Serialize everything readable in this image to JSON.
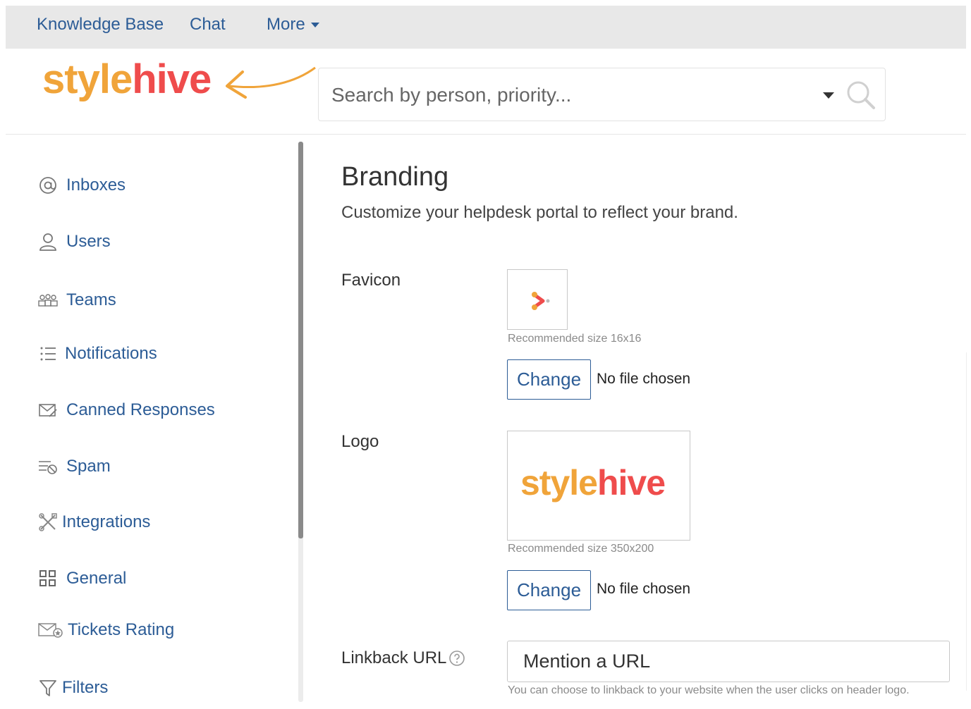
{
  "topnav": {
    "links": [
      {
        "label": "Knowledge Base"
      },
      {
        "label": "Chat"
      },
      {
        "label": "More"
      }
    ]
  },
  "brand": {
    "logo_part1": "style",
    "logo_part2": "hive",
    "colors": {
      "style": "#f0a43a",
      "hive": "#ef4c4c",
      "link": "#2c5c96"
    }
  },
  "search": {
    "placeholder": "Search by person, priority..."
  },
  "sidebar": {
    "items": [
      {
        "label": "Inboxes",
        "icon": "at-icon"
      },
      {
        "label": "Users",
        "icon": "user-icon"
      },
      {
        "label": "Teams",
        "icon": "teams-icon"
      },
      {
        "label": "Notifications",
        "icon": "list-icon"
      },
      {
        "label": "Canned Responses",
        "icon": "envelope-icon"
      },
      {
        "label": "Spam",
        "icon": "spam-icon"
      },
      {
        "label": "Integrations",
        "icon": "tools-icon"
      },
      {
        "label": "General",
        "icon": "grid-icon"
      },
      {
        "label": "Tickets Rating",
        "icon": "rating-envelope-icon"
      },
      {
        "label": "Filters",
        "icon": "funnel-icon"
      }
    ]
  },
  "main": {
    "title": "Branding",
    "subtitle": "Customize your helpdesk portal to reflect your brand.",
    "favicon": {
      "label": "Favicon",
      "hint": "Recommended size 16x16",
      "button": "Change",
      "status": "No file chosen"
    },
    "logo": {
      "label": "Logo",
      "hint": "Recommended size 350x200",
      "button": "Change",
      "status": "No file chosen"
    },
    "linkback": {
      "label": "Linkback URL",
      "placeholder": "Mention a URL",
      "hint": "You can choose to linkback to your website when the user clicks on header logo."
    }
  }
}
